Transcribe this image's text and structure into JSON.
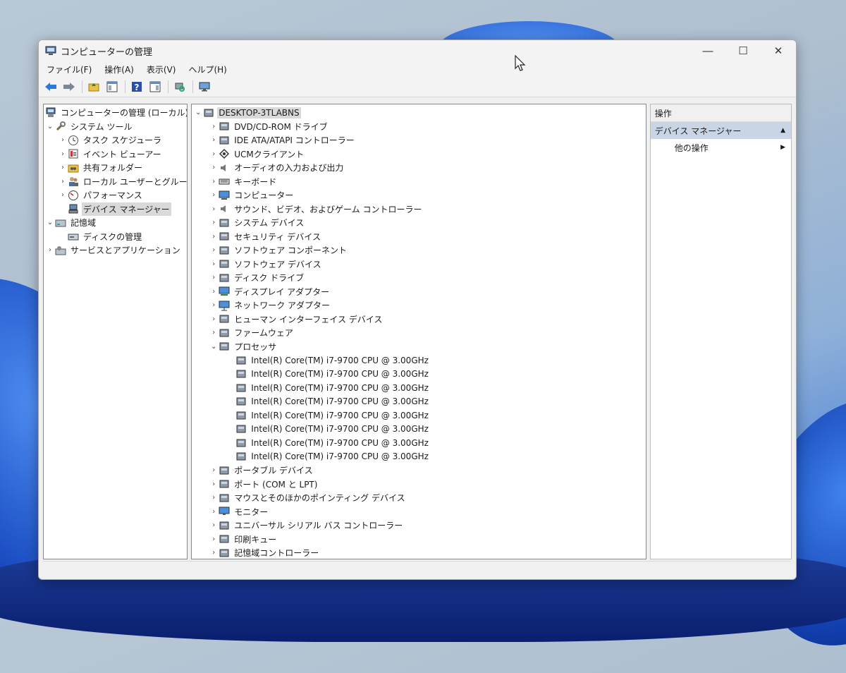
{
  "window": {
    "title": "コンピューターの管理"
  },
  "menu": [
    "ファイル(F)",
    "操作(A)",
    "表示(V)",
    "ヘルプ(H)"
  ],
  "left_tree": {
    "root": "コンピューターの管理 (ローカル)",
    "system_tools": "システム ツール",
    "items": [
      "タスク スケジューラ",
      "イベント ビューアー",
      "共有フォルダー",
      "ローカル ユーザーとグループ",
      "パフォーマンス",
      "デバイス マネージャー"
    ],
    "storage": "記憶域",
    "disk_management": "ディスクの管理",
    "services": "サービスとアプリケーション"
  },
  "device_tree": {
    "root": "DESKTOP-3TLABNS",
    "categories_before": [
      "DVD/CD-ROM ドライブ",
      "IDE ATA/ATAPI コントローラー",
      "UCMクライアント",
      "オーディオの入力および出力",
      "キーボード",
      "コンピューター",
      "サウンド、ビデオ、およびゲーム コントローラー",
      "システム デバイス",
      "セキュリティ デバイス",
      "ソフトウェア コンポーネント",
      "ソフトウェア デバイス",
      "ディスク ドライブ",
      "ディスプレイ アダプター",
      "ネットワーク アダプター",
      "ヒューマン インターフェイス デバイス",
      "ファームウェア"
    ],
    "expanded_category": "プロセッサ",
    "processors": [
      "Intel(R) Core(TM) i7-9700 CPU @ 3.00GHz",
      "Intel(R) Core(TM) i7-9700 CPU @ 3.00GHz",
      "Intel(R) Core(TM) i7-9700 CPU @ 3.00GHz",
      "Intel(R) Core(TM) i7-9700 CPU @ 3.00GHz",
      "Intel(R) Core(TM) i7-9700 CPU @ 3.00GHz",
      "Intel(R) Core(TM) i7-9700 CPU @ 3.00GHz",
      "Intel(R) Core(TM) i7-9700 CPU @ 3.00GHz",
      "Intel(R) Core(TM) i7-9700 CPU @ 3.00GHz"
    ],
    "categories_after": [
      "ポータブル デバイス",
      "ポート (COM と LPT)",
      "マウスとそのほかのポインティング デバイス",
      "モニター",
      "ユニバーサル シリアル バス コントローラー",
      "印刷キュー",
      "記憶域コントローラー"
    ]
  },
  "actions_pane": {
    "header": "操作",
    "section": "デバイス マネージャー",
    "more_actions": "他の操作"
  },
  "colors": {
    "selection": "#d9d9d9",
    "ops_section_bg": "#c9d4e4",
    "accent": "#2f6fd8"
  }
}
